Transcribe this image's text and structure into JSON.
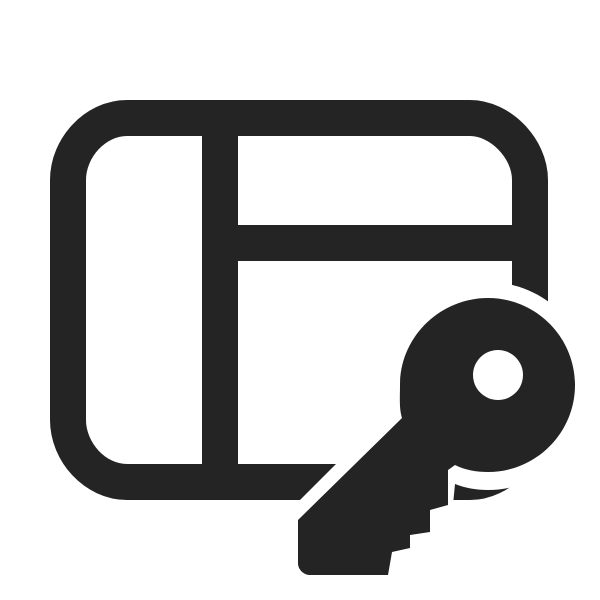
{
  "icon": {
    "name": "layout-key-icon",
    "color": "#242424",
    "background": "#ffffff"
  }
}
